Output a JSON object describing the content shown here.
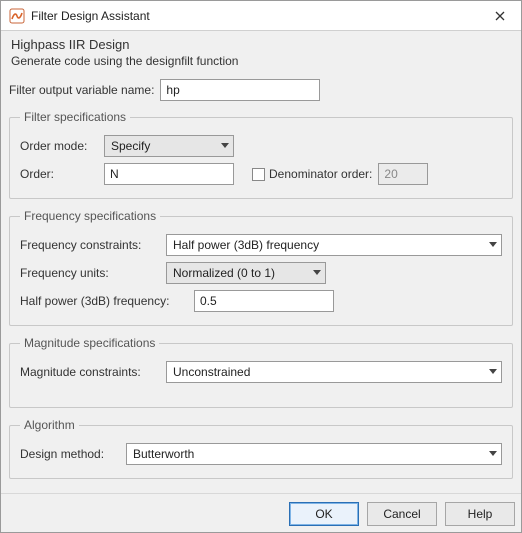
{
  "window": {
    "title": "Filter Design Assistant"
  },
  "header": {
    "title": "Highpass IIR Design",
    "subtitle": "Generate code using the designfilt function"
  },
  "outputVar": {
    "label": "Filter output variable name:",
    "value": "hp"
  },
  "filterSpec": {
    "legend": "Filter specifications",
    "orderModeLabel": "Order mode:",
    "orderModeValue": "Specify",
    "orderLabel": "Order:",
    "orderValue": "N",
    "denomOrderLabel": "Denominator order:",
    "denomOrderValue": "20",
    "denomChecked": false
  },
  "freqSpec": {
    "legend": "Frequency specifications",
    "constraintsLabel": "Frequency constraints:",
    "constraintsValue": "Half power (3dB) frequency",
    "unitsLabel": "Frequency units:",
    "unitsValue": "Normalized (0 to 1)",
    "hpfLabel": "Half power (3dB) frequency:",
    "hpfValue": "0.5"
  },
  "magSpec": {
    "legend": "Magnitude specifications",
    "constraintsLabel": "Magnitude constraints:",
    "constraintsValue": "Unconstrained"
  },
  "algo": {
    "legend": "Algorithm",
    "methodLabel": "Design method:",
    "methodValue": "Butterworth"
  },
  "buttons": {
    "ok": "OK",
    "cancel": "Cancel",
    "help": "Help"
  }
}
